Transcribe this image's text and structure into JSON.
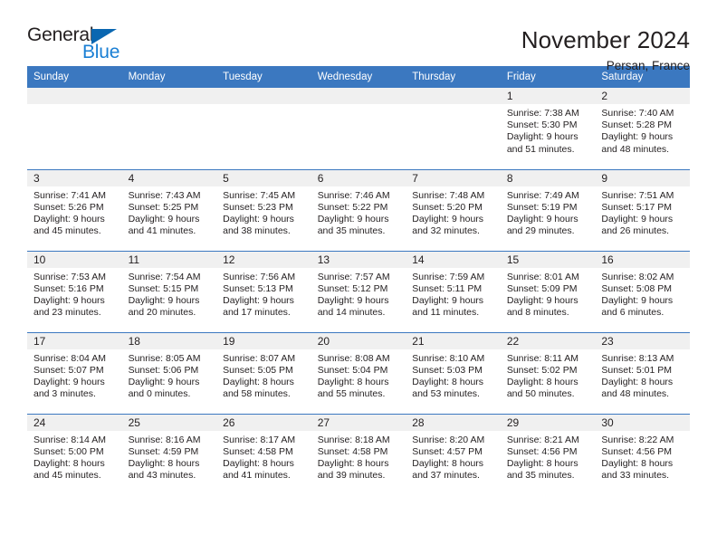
{
  "logo": {
    "word_top": "General",
    "word_bottom": "Blue",
    "accent_color": "#0a67b1",
    "blue_text_color": "#1a7fd4"
  },
  "header": {
    "title": "November 2024",
    "location": "Persan, France",
    "header_bg": "#3b78c0",
    "daynum_bg": "#f0f0f0"
  },
  "weekdays": [
    "Sunday",
    "Monday",
    "Tuesday",
    "Wednesday",
    "Thursday",
    "Friday",
    "Saturday"
  ],
  "weeks": [
    [
      {
        "day": "",
        "sunrise": "",
        "sunset": "",
        "daylight_line1": "",
        "daylight_line2": ""
      },
      {
        "day": "",
        "sunrise": "",
        "sunset": "",
        "daylight_line1": "",
        "daylight_line2": ""
      },
      {
        "day": "",
        "sunrise": "",
        "sunset": "",
        "daylight_line1": "",
        "daylight_line2": ""
      },
      {
        "day": "",
        "sunrise": "",
        "sunset": "",
        "daylight_line1": "",
        "daylight_line2": ""
      },
      {
        "day": "",
        "sunrise": "",
        "sunset": "",
        "daylight_line1": "",
        "daylight_line2": ""
      },
      {
        "day": "1",
        "sunrise": "Sunrise: 7:38 AM",
        "sunset": "Sunset: 5:30 PM",
        "daylight_line1": "Daylight: 9 hours",
        "daylight_line2": "and 51 minutes."
      },
      {
        "day": "2",
        "sunrise": "Sunrise: 7:40 AM",
        "sunset": "Sunset: 5:28 PM",
        "daylight_line1": "Daylight: 9 hours",
        "daylight_line2": "and 48 minutes."
      }
    ],
    [
      {
        "day": "3",
        "sunrise": "Sunrise: 7:41 AM",
        "sunset": "Sunset: 5:26 PM",
        "daylight_line1": "Daylight: 9 hours",
        "daylight_line2": "and 45 minutes."
      },
      {
        "day": "4",
        "sunrise": "Sunrise: 7:43 AM",
        "sunset": "Sunset: 5:25 PM",
        "daylight_line1": "Daylight: 9 hours",
        "daylight_line2": "and 41 minutes."
      },
      {
        "day": "5",
        "sunrise": "Sunrise: 7:45 AM",
        "sunset": "Sunset: 5:23 PM",
        "daylight_line1": "Daylight: 9 hours",
        "daylight_line2": "and 38 minutes."
      },
      {
        "day": "6",
        "sunrise": "Sunrise: 7:46 AM",
        "sunset": "Sunset: 5:22 PM",
        "daylight_line1": "Daylight: 9 hours",
        "daylight_line2": "and 35 minutes."
      },
      {
        "day": "7",
        "sunrise": "Sunrise: 7:48 AM",
        "sunset": "Sunset: 5:20 PM",
        "daylight_line1": "Daylight: 9 hours",
        "daylight_line2": "and 32 minutes."
      },
      {
        "day": "8",
        "sunrise": "Sunrise: 7:49 AM",
        "sunset": "Sunset: 5:19 PM",
        "daylight_line1": "Daylight: 9 hours",
        "daylight_line2": "and 29 minutes."
      },
      {
        "day": "9",
        "sunrise": "Sunrise: 7:51 AM",
        "sunset": "Sunset: 5:17 PM",
        "daylight_line1": "Daylight: 9 hours",
        "daylight_line2": "and 26 minutes."
      }
    ],
    [
      {
        "day": "10",
        "sunrise": "Sunrise: 7:53 AM",
        "sunset": "Sunset: 5:16 PM",
        "daylight_line1": "Daylight: 9 hours",
        "daylight_line2": "and 23 minutes."
      },
      {
        "day": "11",
        "sunrise": "Sunrise: 7:54 AM",
        "sunset": "Sunset: 5:15 PM",
        "daylight_line1": "Daylight: 9 hours",
        "daylight_line2": "and 20 minutes."
      },
      {
        "day": "12",
        "sunrise": "Sunrise: 7:56 AM",
        "sunset": "Sunset: 5:13 PM",
        "daylight_line1": "Daylight: 9 hours",
        "daylight_line2": "and 17 minutes."
      },
      {
        "day": "13",
        "sunrise": "Sunrise: 7:57 AM",
        "sunset": "Sunset: 5:12 PM",
        "daylight_line1": "Daylight: 9 hours",
        "daylight_line2": "and 14 minutes."
      },
      {
        "day": "14",
        "sunrise": "Sunrise: 7:59 AM",
        "sunset": "Sunset: 5:11 PM",
        "daylight_line1": "Daylight: 9 hours",
        "daylight_line2": "and 11 minutes."
      },
      {
        "day": "15",
        "sunrise": "Sunrise: 8:01 AM",
        "sunset": "Sunset: 5:09 PM",
        "daylight_line1": "Daylight: 9 hours",
        "daylight_line2": "and 8 minutes."
      },
      {
        "day": "16",
        "sunrise": "Sunrise: 8:02 AM",
        "sunset": "Sunset: 5:08 PM",
        "daylight_line1": "Daylight: 9 hours",
        "daylight_line2": "and 6 minutes."
      }
    ],
    [
      {
        "day": "17",
        "sunrise": "Sunrise: 8:04 AM",
        "sunset": "Sunset: 5:07 PM",
        "daylight_line1": "Daylight: 9 hours",
        "daylight_line2": "and 3 minutes."
      },
      {
        "day": "18",
        "sunrise": "Sunrise: 8:05 AM",
        "sunset": "Sunset: 5:06 PM",
        "daylight_line1": "Daylight: 9 hours",
        "daylight_line2": "and 0 minutes."
      },
      {
        "day": "19",
        "sunrise": "Sunrise: 8:07 AM",
        "sunset": "Sunset: 5:05 PM",
        "daylight_line1": "Daylight: 8 hours",
        "daylight_line2": "and 58 minutes."
      },
      {
        "day": "20",
        "sunrise": "Sunrise: 8:08 AM",
        "sunset": "Sunset: 5:04 PM",
        "daylight_line1": "Daylight: 8 hours",
        "daylight_line2": "and 55 minutes."
      },
      {
        "day": "21",
        "sunrise": "Sunrise: 8:10 AM",
        "sunset": "Sunset: 5:03 PM",
        "daylight_line1": "Daylight: 8 hours",
        "daylight_line2": "and 53 minutes."
      },
      {
        "day": "22",
        "sunrise": "Sunrise: 8:11 AM",
        "sunset": "Sunset: 5:02 PM",
        "daylight_line1": "Daylight: 8 hours",
        "daylight_line2": "and 50 minutes."
      },
      {
        "day": "23",
        "sunrise": "Sunrise: 8:13 AM",
        "sunset": "Sunset: 5:01 PM",
        "daylight_line1": "Daylight: 8 hours",
        "daylight_line2": "and 48 minutes."
      }
    ],
    [
      {
        "day": "24",
        "sunrise": "Sunrise: 8:14 AM",
        "sunset": "Sunset: 5:00 PM",
        "daylight_line1": "Daylight: 8 hours",
        "daylight_line2": "and 45 minutes."
      },
      {
        "day": "25",
        "sunrise": "Sunrise: 8:16 AM",
        "sunset": "Sunset: 4:59 PM",
        "daylight_line1": "Daylight: 8 hours",
        "daylight_line2": "and 43 minutes."
      },
      {
        "day": "26",
        "sunrise": "Sunrise: 8:17 AM",
        "sunset": "Sunset: 4:58 PM",
        "daylight_line1": "Daylight: 8 hours",
        "daylight_line2": "and 41 minutes."
      },
      {
        "day": "27",
        "sunrise": "Sunrise: 8:18 AM",
        "sunset": "Sunset: 4:58 PM",
        "daylight_line1": "Daylight: 8 hours",
        "daylight_line2": "and 39 minutes."
      },
      {
        "day": "28",
        "sunrise": "Sunrise: 8:20 AM",
        "sunset": "Sunset: 4:57 PM",
        "daylight_line1": "Daylight: 8 hours",
        "daylight_line2": "and 37 minutes."
      },
      {
        "day": "29",
        "sunrise": "Sunrise: 8:21 AM",
        "sunset": "Sunset: 4:56 PM",
        "daylight_line1": "Daylight: 8 hours",
        "daylight_line2": "and 35 minutes."
      },
      {
        "day": "30",
        "sunrise": "Sunrise: 8:22 AM",
        "sunset": "Sunset: 4:56 PM",
        "daylight_line1": "Daylight: 8 hours",
        "daylight_line2": "and 33 minutes."
      }
    ]
  ]
}
